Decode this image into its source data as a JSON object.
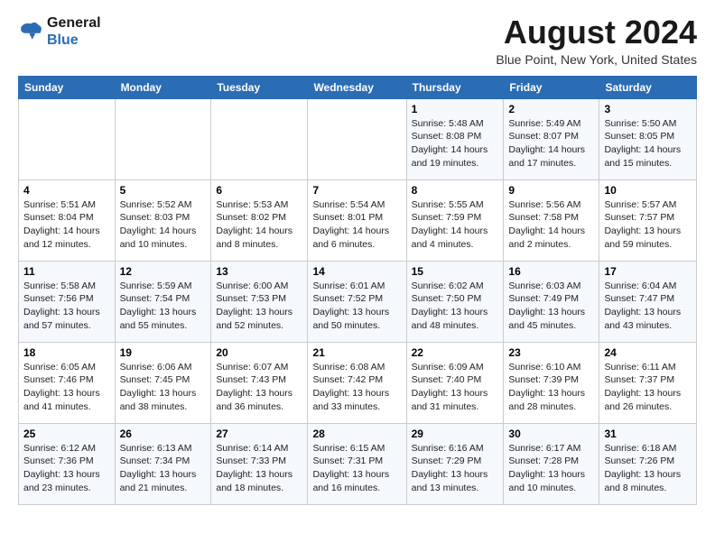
{
  "header": {
    "logo_line1": "General",
    "logo_line2": "Blue",
    "month": "August 2024",
    "location": "Blue Point, New York, United States"
  },
  "days_of_week": [
    "Sunday",
    "Monday",
    "Tuesday",
    "Wednesday",
    "Thursday",
    "Friday",
    "Saturday"
  ],
  "weeks": [
    [
      {
        "day": "",
        "info": ""
      },
      {
        "day": "",
        "info": ""
      },
      {
        "day": "",
        "info": ""
      },
      {
        "day": "",
        "info": ""
      },
      {
        "day": "1",
        "info": "Sunrise: 5:48 AM\nSunset: 8:08 PM\nDaylight: 14 hours\nand 19 minutes."
      },
      {
        "day": "2",
        "info": "Sunrise: 5:49 AM\nSunset: 8:07 PM\nDaylight: 14 hours\nand 17 minutes."
      },
      {
        "day": "3",
        "info": "Sunrise: 5:50 AM\nSunset: 8:05 PM\nDaylight: 14 hours\nand 15 minutes."
      }
    ],
    [
      {
        "day": "4",
        "info": "Sunrise: 5:51 AM\nSunset: 8:04 PM\nDaylight: 14 hours\nand 12 minutes."
      },
      {
        "day": "5",
        "info": "Sunrise: 5:52 AM\nSunset: 8:03 PM\nDaylight: 14 hours\nand 10 minutes."
      },
      {
        "day": "6",
        "info": "Sunrise: 5:53 AM\nSunset: 8:02 PM\nDaylight: 14 hours\nand 8 minutes."
      },
      {
        "day": "7",
        "info": "Sunrise: 5:54 AM\nSunset: 8:01 PM\nDaylight: 14 hours\nand 6 minutes."
      },
      {
        "day": "8",
        "info": "Sunrise: 5:55 AM\nSunset: 7:59 PM\nDaylight: 14 hours\nand 4 minutes."
      },
      {
        "day": "9",
        "info": "Sunrise: 5:56 AM\nSunset: 7:58 PM\nDaylight: 14 hours\nand 2 minutes."
      },
      {
        "day": "10",
        "info": "Sunrise: 5:57 AM\nSunset: 7:57 PM\nDaylight: 13 hours\nand 59 minutes."
      }
    ],
    [
      {
        "day": "11",
        "info": "Sunrise: 5:58 AM\nSunset: 7:56 PM\nDaylight: 13 hours\nand 57 minutes."
      },
      {
        "day": "12",
        "info": "Sunrise: 5:59 AM\nSunset: 7:54 PM\nDaylight: 13 hours\nand 55 minutes."
      },
      {
        "day": "13",
        "info": "Sunrise: 6:00 AM\nSunset: 7:53 PM\nDaylight: 13 hours\nand 52 minutes."
      },
      {
        "day": "14",
        "info": "Sunrise: 6:01 AM\nSunset: 7:52 PM\nDaylight: 13 hours\nand 50 minutes."
      },
      {
        "day": "15",
        "info": "Sunrise: 6:02 AM\nSunset: 7:50 PM\nDaylight: 13 hours\nand 48 minutes."
      },
      {
        "day": "16",
        "info": "Sunrise: 6:03 AM\nSunset: 7:49 PM\nDaylight: 13 hours\nand 45 minutes."
      },
      {
        "day": "17",
        "info": "Sunrise: 6:04 AM\nSunset: 7:47 PM\nDaylight: 13 hours\nand 43 minutes."
      }
    ],
    [
      {
        "day": "18",
        "info": "Sunrise: 6:05 AM\nSunset: 7:46 PM\nDaylight: 13 hours\nand 41 minutes."
      },
      {
        "day": "19",
        "info": "Sunrise: 6:06 AM\nSunset: 7:45 PM\nDaylight: 13 hours\nand 38 minutes."
      },
      {
        "day": "20",
        "info": "Sunrise: 6:07 AM\nSunset: 7:43 PM\nDaylight: 13 hours\nand 36 minutes."
      },
      {
        "day": "21",
        "info": "Sunrise: 6:08 AM\nSunset: 7:42 PM\nDaylight: 13 hours\nand 33 minutes."
      },
      {
        "day": "22",
        "info": "Sunrise: 6:09 AM\nSunset: 7:40 PM\nDaylight: 13 hours\nand 31 minutes."
      },
      {
        "day": "23",
        "info": "Sunrise: 6:10 AM\nSunset: 7:39 PM\nDaylight: 13 hours\nand 28 minutes."
      },
      {
        "day": "24",
        "info": "Sunrise: 6:11 AM\nSunset: 7:37 PM\nDaylight: 13 hours\nand 26 minutes."
      }
    ],
    [
      {
        "day": "25",
        "info": "Sunrise: 6:12 AM\nSunset: 7:36 PM\nDaylight: 13 hours\nand 23 minutes."
      },
      {
        "day": "26",
        "info": "Sunrise: 6:13 AM\nSunset: 7:34 PM\nDaylight: 13 hours\nand 21 minutes."
      },
      {
        "day": "27",
        "info": "Sunrise: 6:14 AM\nSunset: 7:33 PM\nDaylight: 13 hours\nand 18 minutes."
      },
      {
        "day": "28",
        "info": "Sunrise: 6:15 AM\nSunset: 7:31 PM\nDaylight: 13 hours\nand 16 minutes."
      },
      {
        "day": "29",
        "info": "Sunrise: 6:16 AM\nSunset: 7:29 PM\nDaylight: 13 hours\nand 13 minutes."
      },
      {
        "day": "30",
        "info": "Sunrise: 6:17 AM\nSunset: 7:28 PM\nDaylight: 13 hours\nand 10 minutes."
      },
      {
        "day": "31",
        "info": "Sunrise: 6:18 AM\nSunset: 7:26 PM\nDaylight: 13 hours\nand 8 minutes."
      }
    ]
  ]
}
